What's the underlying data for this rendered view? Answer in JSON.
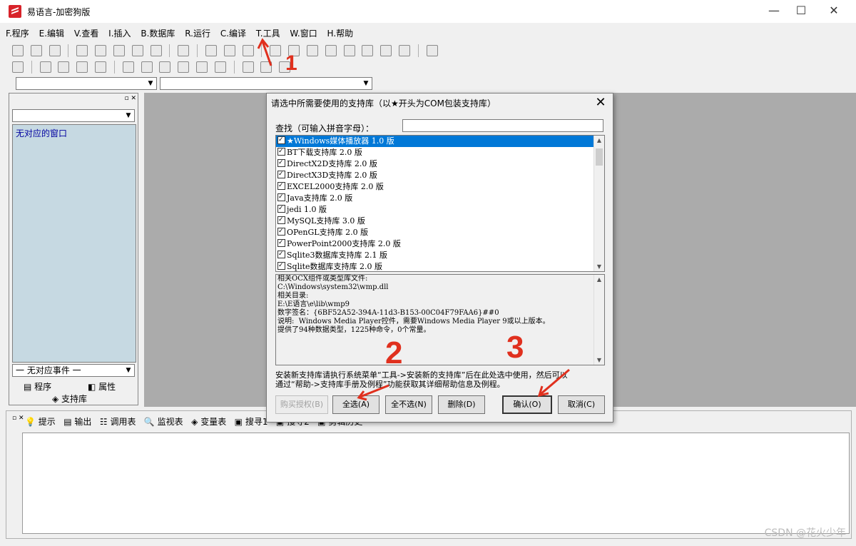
{
  "window": {
    "title": "易语言-加密狗版",
    "buttons": [
      "—",
      "☐",
      "✕"
    ]
  },
  "menu": [
    "F.程序",
    "E.编辑",
    "V.查看",
    "I.插入",
    "B.数据库",
    "R.运行",
    "C.编译",
    "T.工具",
    "W.窗口",
    "H.帮助"
  ],
  "left_panel": {
    "list_item": "无对应的窗口",
    "event_combo": "一 无对应事件 一",
    "tab_program": "程序",
    "tab_property": "属性",
    "tab_library": "支持库"
  },
  "bottom_tabs": [
    "提示",
    "输出",
    "调用表",
    "监视表",
    "变量表",
    "搜寻1",
    "搜寻2",
    "剪辑历史"
  ],
  "dialog": {
    "title": "请选中所需要使用的支持库（以★开头为COM包装支持库）",
    "close": "✕",
    "search_label": "查找（可输入拼音字母）：",
    "search_value": "",
    "libraries": [
      "★Windows媒体播放器 1.0 版",
      "BT下载支持库 2.0 版",
      "DirectX2D支持库 2.0 版",
      "DirectX3D支持库 2.0 版",
      "EXCEL2000支持库 2.0 版",
      "Java支持库 2.0 版",
      "jedi 1.0 版",
      "MySQL支持库 3.0 版",
      "OPenGL支持库 2.0 版",
      "PowerPoint2000支持库 2.0 版",
      "Sqlite3数据库支持库 2.1 版",
      "Sqlite数据库支持库 2.0 版"
    ],
    "info_lines": [
      "相关OCX组件或类型库文件:",
      "C:\\Windows\\system32\\wmp.dll",
      "相关目录:",
      "E:\\E语言\\e\\lib\\wmp9",
      "",
      "数字签名：{6BF52A52-394A-11d3-B153-00C04F79FAA6}##0",
      "说明:  Windows Media Player控件，需要Windows Media Player 9或以上版本。",
      "提供了94种数据类型，1225种命令，0个常量。"
    ],
    "hint_line1": "安装新支持库请执行系统菜单“工具->安装新的支持库”后在此处选中使用，然后可以",
    "hint_line2": "通过“帮助->支持库手册及例程”功能获取其详细帮助信息及例程。",
    "btn_buy": "购买授权(B)",
    "btn_select_all": "全选(A)",
    "btn_select_none": "全不选(N)",
    "btn_delete": "删除(D)",
    "btn_ok": "确认(O)",
    "btn_cancel": "取消(C)"
  },
  "annotations": [
    "1",
    "2",
    "3"
  ],
  "watermark": "CSDN @花火少年"
}
